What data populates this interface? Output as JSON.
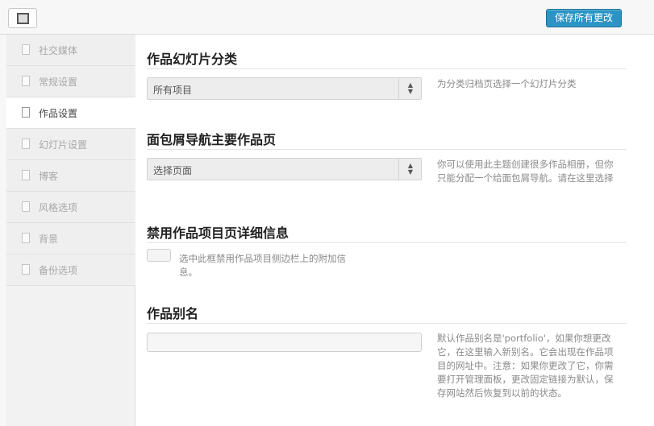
{
  "toolbar": {
    "menu_icon": "panel-square-icon",
    "save_label": "保存所有更改",
    "save_color": "#2a95c5"
  },
  "sidebar": {
    "items": [
      {
        "label": "社交媒体",
        "icon": "document-icon",
        "active": false
      },
      {
        "label": "常规设置",
        "icon": "document-icon",
        "active": false
      },
      {
        "label": "作品设置",
        "icon": "document-icon",
        "active": true
      },
      {
        "label": "幻灯片设置",
        "icon": "document-icon",
        "active": false
      },
      {
        "label": "博客",
        "icon": "document-icon",
        "active": false
      },
      {
        "label": "风格选项",
        "icon": "document-icon",
        "active": false
      },
      {
        "label": "背景",
        "icon": "document-icon",
        "active": false
      },
      {
        "label": "备份选项",
        "icon": "document-icon",
        "active": false
      }
    ]
  },
  "main": {
    "sections": [
      {
        "title": "作品幻灯片分类",
        "control": "select",
        "value": "所有项目",
        "description": "为分类归档页选择一个幻灯片分类"
      },
      {
        "title": "面包屑导航主要作品页",
        "control": "select",
        "value": "选择页面",
        "description": "你可以使用此主题创建很多作品相册，但你只能分配一个给面包屑导航。请在这里选择"
      },
      {
        "title": "禁用作品项目页详细信息",
        "control": "checkbox",
        "checked": false,
        "description": "选中此框禁用作品项目侧边栏上的附加信息。"
      },
      {
        "title": "作品别名",
        "control": "text",
        "value": "",
        "description": "默认作品别名是'portfolio'，如果你想更改它，在这里输入新别名。它会出现在作品项目的网址中。注意：如果你更改了它，你需要打开管理面板，更改固定链接为默认，保存网站然后恢复到以前的状态。"
      }
    ]
  }
}
